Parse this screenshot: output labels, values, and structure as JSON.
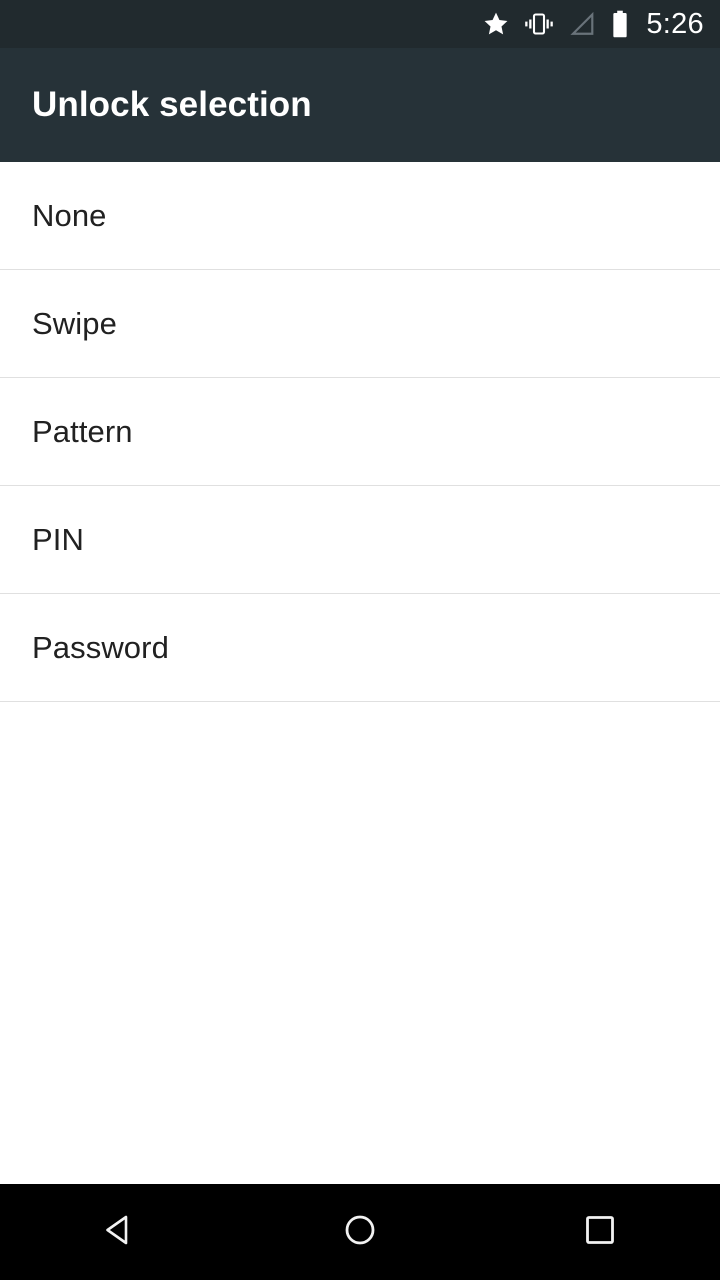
{
  "status_bar": {
    "background_color": "#212a2e",
    "clock": "5:26",
    "icons": [
      {
        "name": "star-icon",
        "label": "starred / priority mode"
      },
      {
        "name": "vibrate-icon",
        "label": "ringer vibrate"
      },
      {
        "name": "signal-icon",
        "label": "cellular signal no bars"
      },
      {
        "name": "battery-icon",
        "label": "battery full"
      }
    ]
  },
  "action_bar": {
    "title": "Unlock selection",
    "background_color": "#263238",
    "title_color": "#ffffff"
  },
  "options_list": {
    "divider_color": "#e0e0e0",
    "text_color": "#212121",
    "items": [
      {
        "label": "None"
      },
      {
        "label": "Swipe"
      },
      {
        "label": "Pattern"
      },
      {
        "label": "PIN"
      },
      {
        "label": "Password"
      }
    ]
  },
  "nav_bar": {
    "background_color": "#000000",
    "buttons": [
      {
        "name": "back-icon",
        "label": "Back"
      },
      {
        "name": "home-icon",
        "label": "Home"
      },
      {
        "name": "recents-icon",
        "label": "Recents"
      }
    ]
  }
}
